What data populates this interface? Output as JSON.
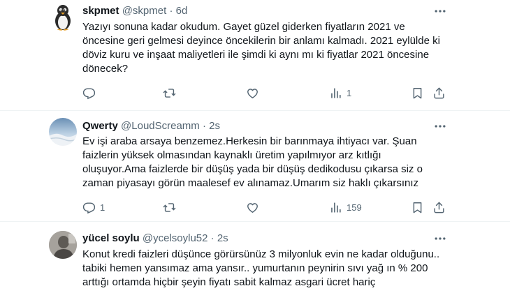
{
  "tweets": [
    {
      "name": "skpmet",
      "handle": "@skpmet",
      "sep": "·",
      "time": "6d",
      "text": "Yazıyı sonuna kadar okudum. Gayet güzel giderken fiyatların 2021 ve öncesine geri gelmesi deyince öncekilerin bir anlamı kalmadı. 2021 eylülde ki döviz kuru ve inşaat maliyetleri ile şimdi ki aynı mı ki fiyatlar 2021 öncesine dönecek?",
      "replies": "",
      "retweets": "",
      "likes": "",
      "views": "1"
    },
    {
      "name": "Qwerty",
      "handle": "@LoudScreamm",
      "sep": "·",
      "time": "2s",
      "text": "Ev işi araba arsaya benzemez.Herkesin bir barınmaya ihtiyacı var. Şuan faizlerin yüksek olmasından kaynaklı üretim yapılmıyor arz kıtlığı oluşuyor.Ama faizlerde bir düşüş yada bir düşüş dedikodusu çıkarsa siz o zaman piyasayı görün maalesef ev alınamaz.Umarım siz haklı çıkarsınız",
      "replies": "1",
      "retweets": "",
      "likes": "",
      "views": "159"
    },
    {
      "name": "yücel soylu",
      "handle": "@ycelsoylu52",
      "sep": "·",
      "time": "2s",
      "text": "Konut kredi faizleri düşünce görürsünüz 3 milyonluk evin ne kadar olduğunu.. tabiki hemen yansımaz ama yansır.. yumurtanın peynirin sıvı yağ ın % 200 arttığı ortamda hiçbir şeyin fiyatı sabit kalmaz asgari ücret hariç"
    }
  ],
  "icons": {
    "more": "more-dots-icon",
    "reply": "reply-icon",
    "retweet": "retweet-icon",
    "like": "like-icon",
    "views": "views-icon",
    "bookmark": "bookmark-icon",
    "share": "share-icon"
  },
  "colors": {
    "text": "#0f1419",
    "secondary": "#536471",
    "divider": "#eff3f4"
  }
}
